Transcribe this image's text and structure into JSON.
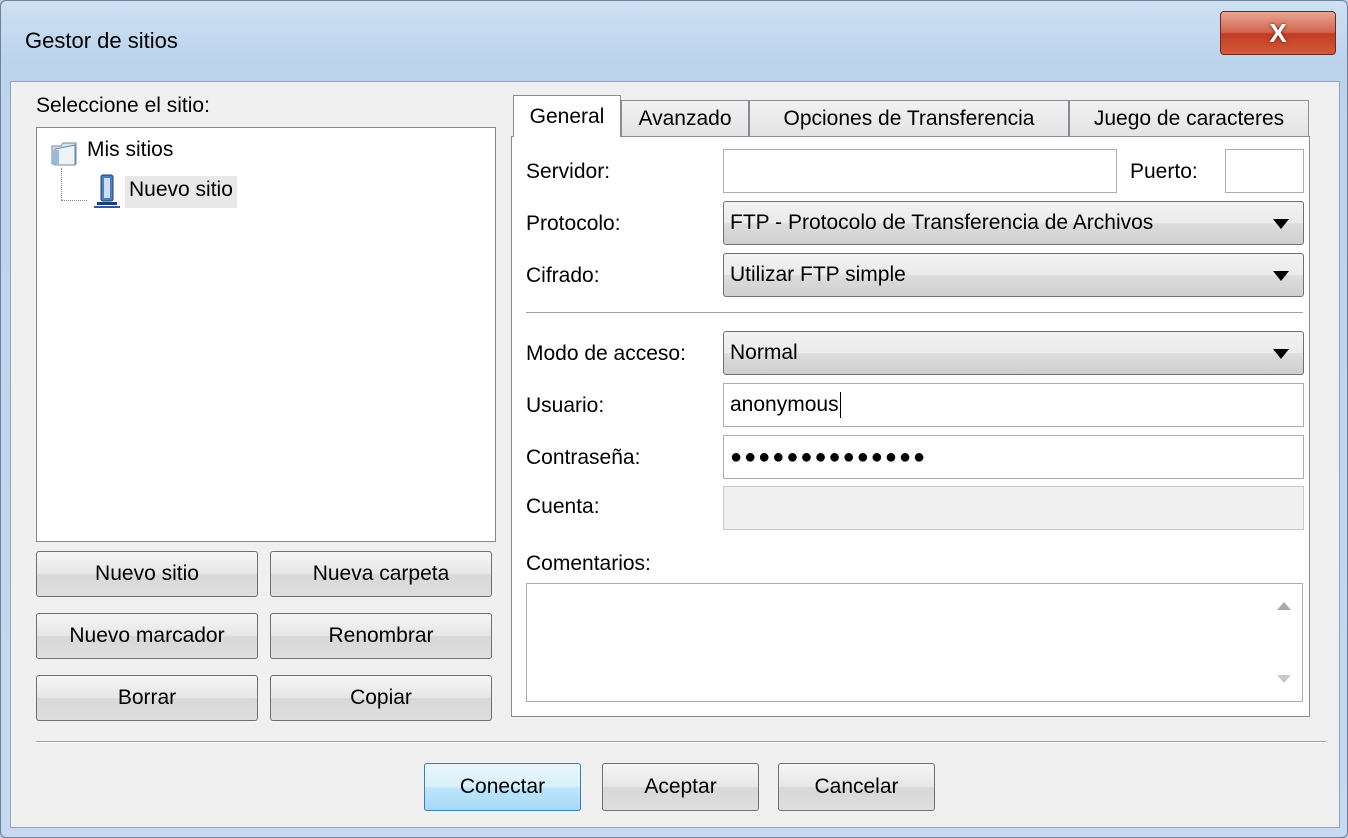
{
  "window": {
    "title": "Gestor de sitios",
    "close_symbol": "X"
  },
  "tree": {
    "label": "Seleccione el sitio:",
    "root": "Mis sitios",
    "child": "Nuevo sitio"
  },
  "site_buttons": {
    "new_site": "Nuevo sitio",
    "new_folder": "Nueva carpeta",
    "new_bookmark": "Nuevo marcador",
    "rename": "Renombrar",
    "delete": "Borrar",
    "copy": "Copiar"
  },
  "tabs": [
    "General",
    "Avanzado",
    "Opciones de Transferencia",
    "Juego de caracteres"
  ],
  "form": {
    "server_label": "Servidor:",
    "server_value": "",
    "port_label": "Puerto:",
    "port_value": "",
    "protocol_label": "Protocolo:",
    "protocol_value": "FTP - Protocolo de Transferencia de Archivos",
    "encryption_label": "Cifrado:",
    "encryption_value": "Utilizar FTP simple",
    "logon_label": "Modo de acceso:",
    "logon_value": "Normal",
    "user_label": "Usuario:",
    "user_value": "anonymous",
    "password_label": "Contraseña:",
    "password_value": "●●●●●●●●●●●●●●",
    "account_label": "Cuenta:",
    "account_value": "",
    "comments_label": "Comentarios:"
  },
  "footer": {
    "connect": "Conectar",
    "ok": "Aceptar",
    "cancel": "Cancelar"
  },
  "icons": {
    "close": "close-icon",
    "folder": "folder-icon",
    "site": "server-icon",
    "dropdown": "chevron-down-icon"
  }
}
